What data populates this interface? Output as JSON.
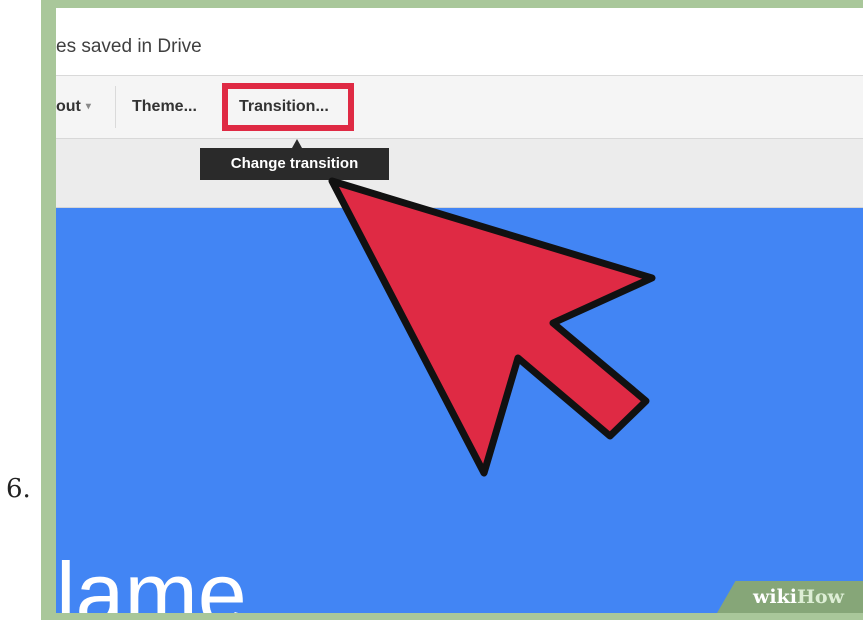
{
  "step": {
    "number": "6."
  },
  "document": {
    "save_status": "es saved in Drive"
  },
  "toolbar": {
    "layout_label": "out",
    "layout_caret": "▾",
    "theme_label": "Theme...",
    "transition_label": "Transition..."
  },
  "tooltip": {
    "text": "Change transition"
  },
  "slide": {
    "title_fragment": "lame"
  },
  "watermark": {
    "wiki": "wiki",
    "how": "How"
  },
  "colors": {
    "frame": "#a9c79a",
    "highlight": "#df2a44",
    "arrow_fill": "#df2a44",
    "slide_background": "#4285f4",
    "tooltip_background": "#2a2a2a"
  },
  "icons": {
    "pointer": "red-arrow-pointer"
  }
}
